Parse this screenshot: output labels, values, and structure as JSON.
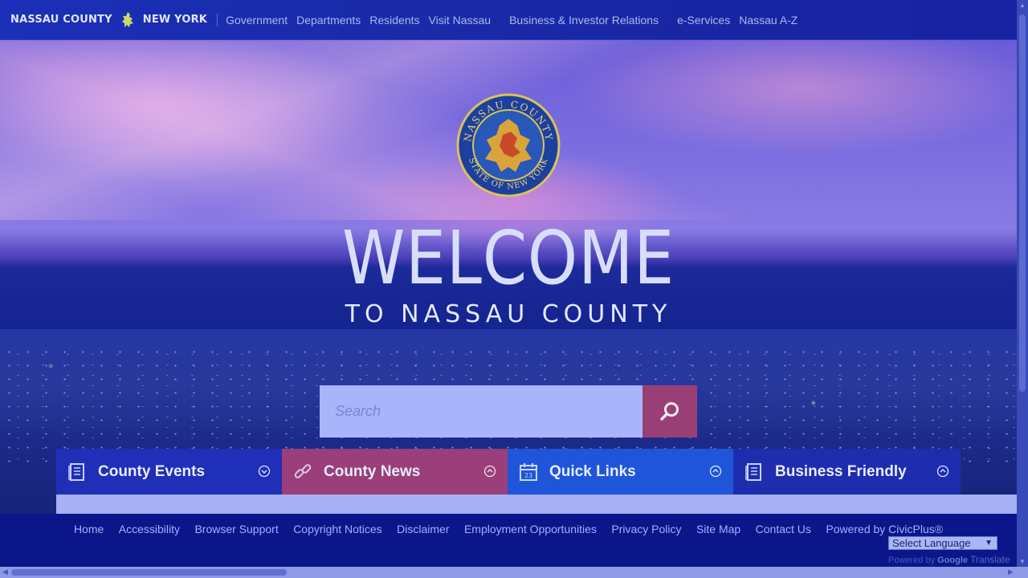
{
  "header": {
    "brand_left": "NASSAU COUNTY",
    "brand_right": "NEW YORK",
    "nav": [
      {
        "label": "Government"
      },
      {
        "label": "Departments"
      },
      {
        "label": "Residents"
      },
      {
        "label": "Visit Nassau"
      },
      {
        "label": "Business & Investor Relations"
      },
      {
        "label": "e-Services"
      },
      {
        "label": "Nassau A-Z"
      }
    ]
  },
  "hero": {
    "title": "WELCOME",
    "subtitle": "TO NASSAU COUNTY",
    "seal_text_top": "NASSAU COUNTY",
    "seal_text_bottom": "STATE OF NEW YORK"
  },
  "search": {
    "placeholder": "Search"
  },
  "tiles": [
    {
      "label": "County Events",
      "icon": "document-icon",
      "chevron": "down"
    },
    {
      "label": "County News",
      "icon": "link-icon",
      "chevron": "up"
    },
    {
      "label": "Quick Links",
      "icon": "calendar-icon",
      "chevron": "up"
    },
    {
      "label": "Business Friendly",
      "icon": "document-icon",
      "chevron": "up"
    }
  ],
  "footer": {
    "links": [
      {
        "label": "Home"
      },
      {
        "label": "Accessibility"
      },
      {
        "label": "Browser Support"
      },
      {
        "label": "Copyright Notices"
      },
      {
        "label": "Disclaimer"
      },
      {
        "label": "Employment Opportunities"
      },
      {
        "label": "Privacy Policy"
      },
      {
        "label": "Site Map"
      },
      {
        "label": "Contact Us"
      },
      {
        "label": "Powered by CivicPlus®"
      }
    ],
    "language_select": "Select Language",
    "powered_by": "Powered by",
    "powered_google": "Google",
    "powered_translate": "Translate"
  },
  "colors": {
    "header_bg": "#1b2fb8",
    "search_button": "#9a3f76",
    "tile_news": "#9a3f7a",
    "tile_quicklinks": "#1f55d8",
    "footer_bg": "#0b168a"
  }
}
